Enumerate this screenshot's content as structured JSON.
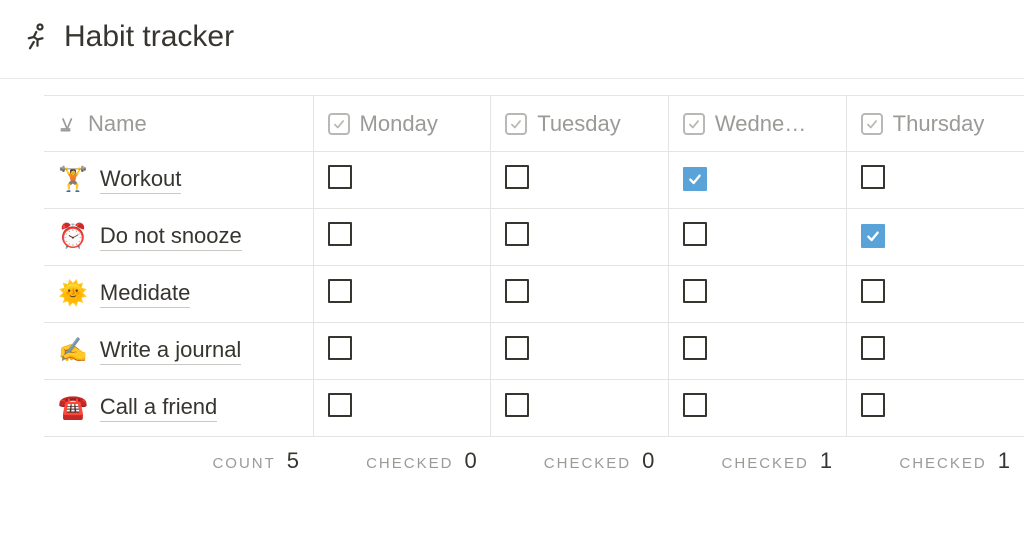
{
  "header": {
    "title": "Habit tracker"
  },
  "columns": {
    "name_label": "Name",
    "days": [
      "Monday",
      "Tuesday",
      "Wedne…",
      "Thursday"
    ]
  },
  "rows": [
    {
      "emoji": "🏋️",
      "label": "Workout",
      "checks": [
        false,
        false,
        true,
        false
      ]
    },
    {
      "emoji": "⏰",
      "label": "Do not snooze",
      "checks": [
        false,
        false,
        false,
        true
      ]
    },
    {
      "emoji": "🌞",
      "label": "Medidate",
      "checks": [
        false,
        false,
        false,
        false
      ]
    },
    {
      "emoji": "✍️",
      "label": "Write a journal",
      "checks": [
        false,
        false,
        false,
        false
      ]
    },
    {
      "emoji": "☎️",
      "label": "Call a friend",
      "checks": [
        false,
        false,
        false,
        false
      ]
    }
  ],
  "footer": {
    "count_label": "COUNT",
    "count_value": "5",
    "checked_label": "CHECKED",
    "day_checked": [
      "0",
      "0",
      "1",
      "1"
    ]
  }
}
